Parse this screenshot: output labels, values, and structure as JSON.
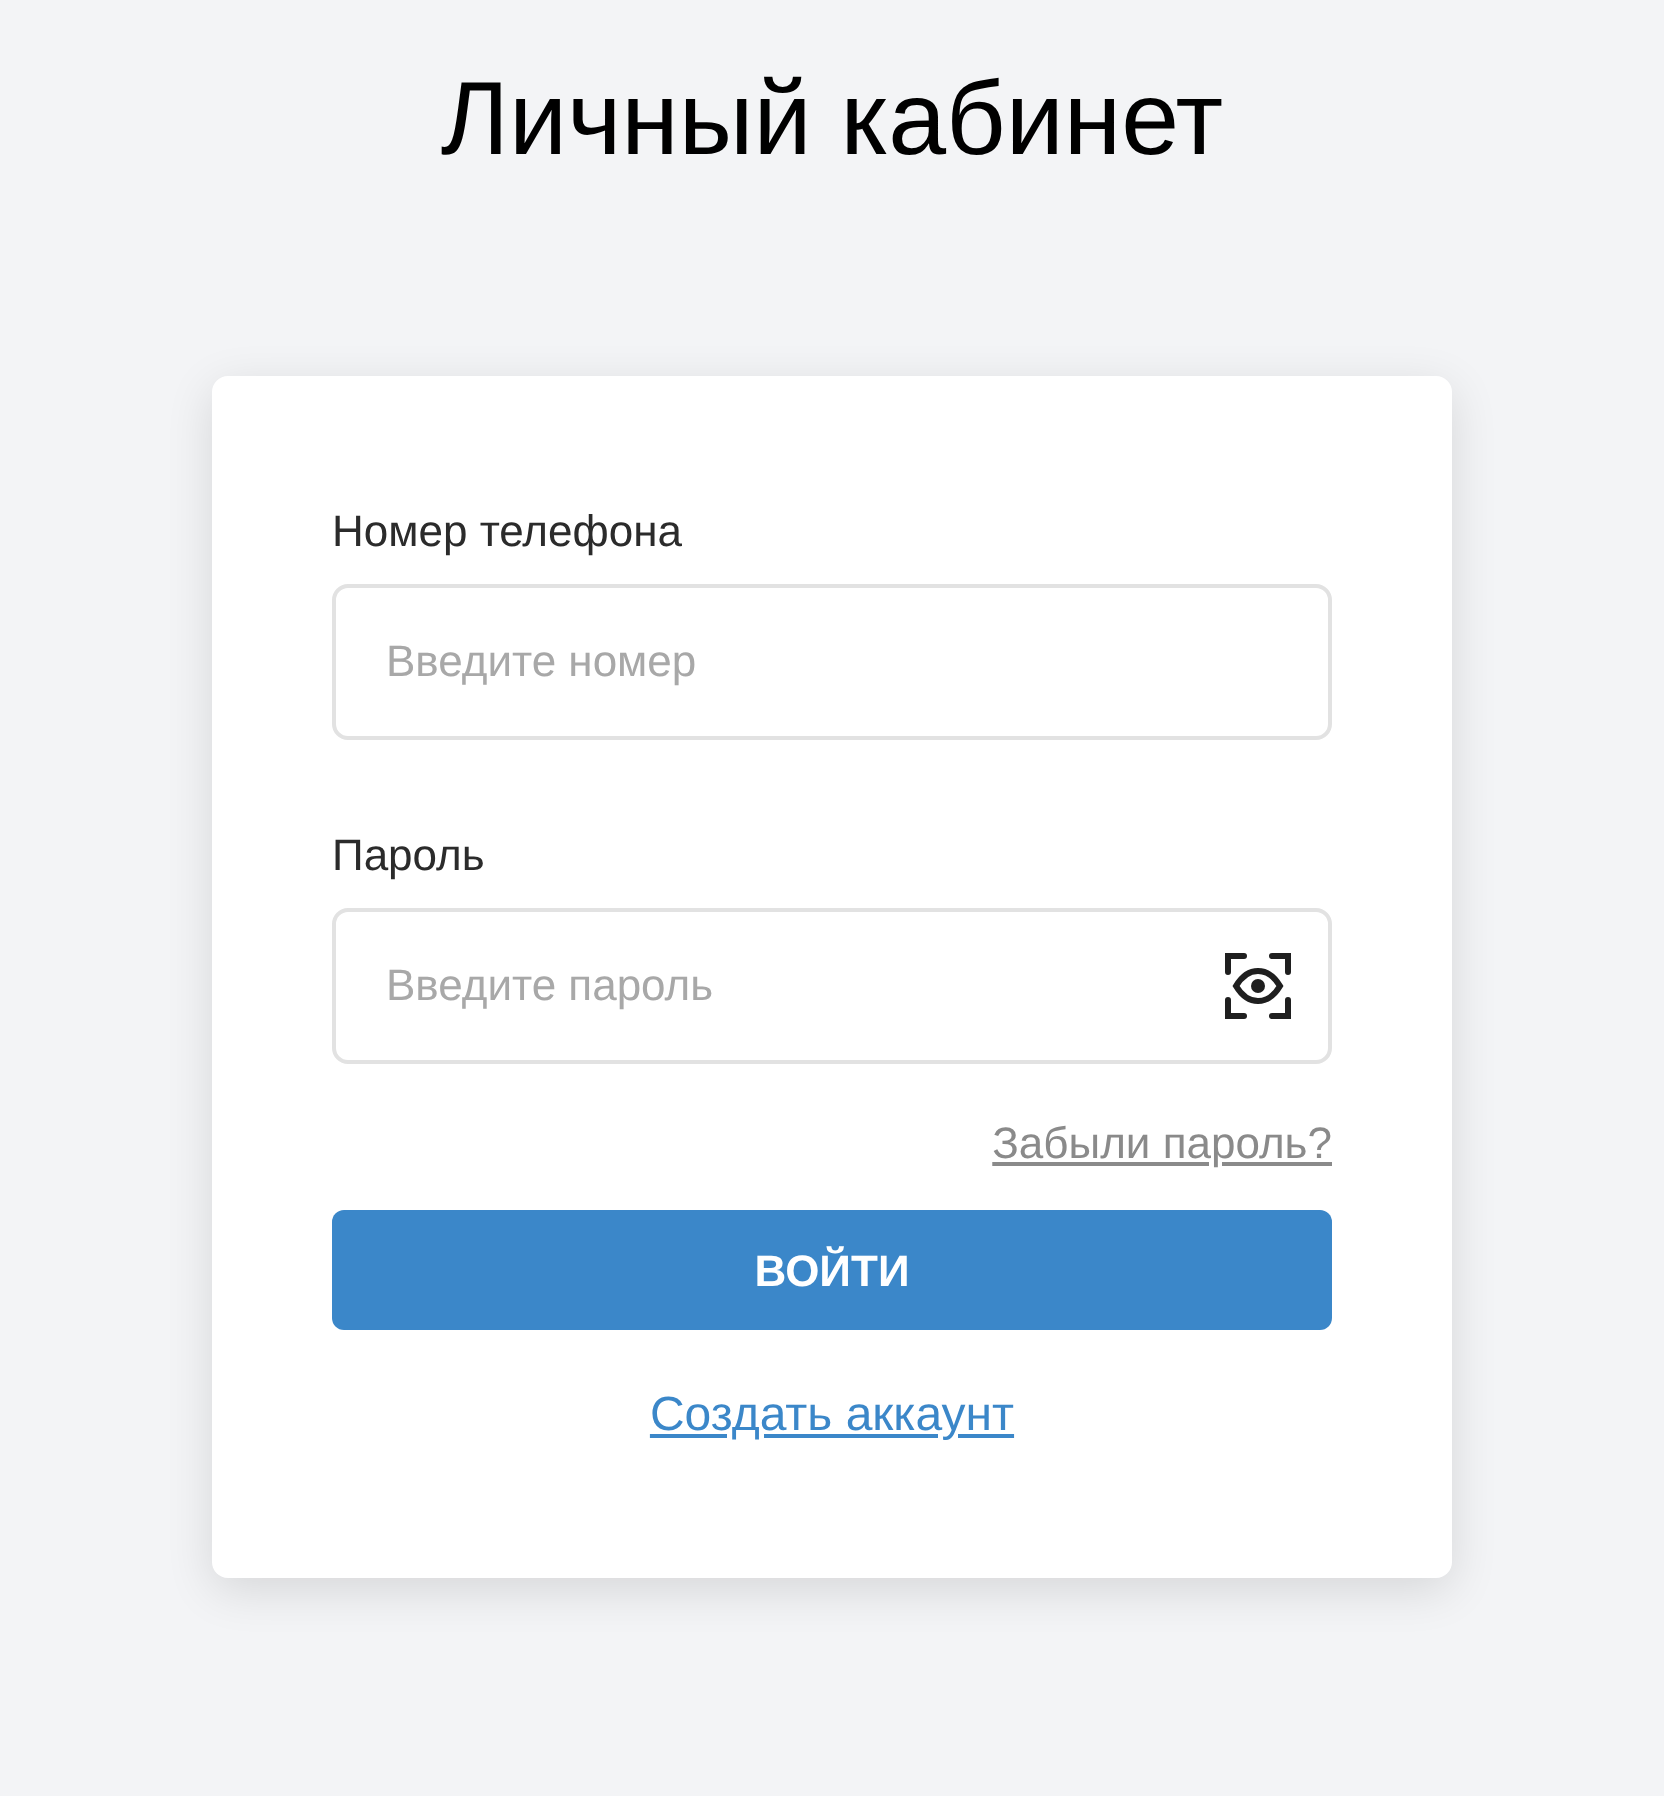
{
  "title": "Личный кабинет",
  "form": {
    "fields": [
      {
        "kind": "text",
        "label": "Номер телефона",
        "placeholder": "Введите номер"
      },
      {
        "kind": "password",
        "label": "Пароль",
        "placeholder": "Введите пароль"
      }
    ],
    "forgot_link": "Забыли пароль?",
    "submit_button": "ВОЙТИ",
    "create_link": "Создать аккаунт"
  }
}
